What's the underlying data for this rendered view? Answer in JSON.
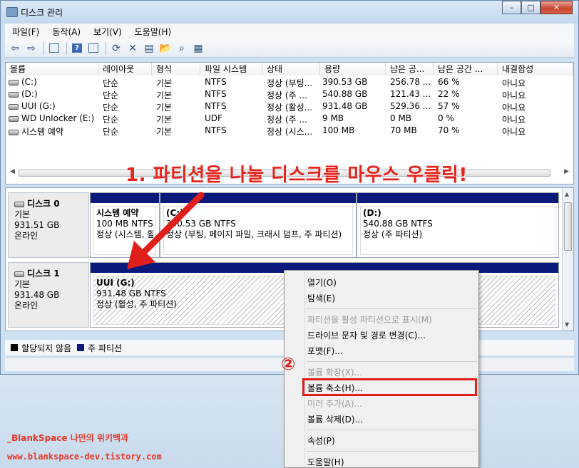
{
  "window": {
    "title": "디스크 관리",
    "buttons": [
      "–",
      "□",
      "✕"
    ]
  },
  "menubar": [
    "파일(F)",
    "동작(A)",
    "보기(V)",
    "도움말(H)"
  ],
  "toolbar": {
    "icons": [
      "back-arrow-icon",
      "forward-arrow-icon",
      "console-icon",
      "help-icon",
      "view-icon",
      "refresh-icon",
      "delete-icon",
      "properties-icon",
      "open-icon",
      "search-icon",
      "settings-icon"
    ]
  },
  "volume_list": {
    "columns": [
      "볼륨",
      "레이아웃",
      "형식",
      "파일 시스템",
      "상태",
      "용량",
      "남은 공...",
      "남은 공간 ...",
      "내결함성"
    ],
    "rows": [
      [
        "(C:)",
        "단순",
        "기본",
        "NTFS",
        "정상 (부팅...",
        "390.53 GB",
        "256.78 ...",
        "66 %",
        "아니요"
      ],
      [
        "(D:)",
        "단순",
        "기본",
        "NTFS",
        "정상 (주 ...",
        "540.88 GB",
        "121.43 ...",
        "22 %",
        "아니요"
      ],
      [
        "UUI (G:)",
        "단순",
        "기본",
        "NTFS",
        "정상 (활성...",
        "931.48 GB",
        "529.36 ...",
        "57 %",
        "아니요"
      ],
      [
        "WD Unlocker (E:)",
        "단순",
        "기본",
        "UDF",
        "정상 (주 ...",
        "9 MB",
        "0 MB",
        "0 %",
        "아니요"
      ],
      [
        "시스템 예약",
        "단순",
        "기본",
        "NTFS",
        "정상 (시스...",
        "100 MB",
        "70 MB",
        "70 %",
        "아니요"
      ]
    ]
  },
  "annotation1": "1. 파티션을 나눌 디스크를 마우스 우클릭!",
  "disks": [
    {
      "name": "디스크 0",
      "type": "기본",
      "size": "931.51 GB",
      "state": "온라인",
      "partitions": [
        {
          "name": "시스템 예약",
          "size": "100 MB NTFS",
          "status": "정상 (시스템, 활"
        },
        {
          "name": "(C:)",
          "size": "390.53 GB NTFS",
          "status": "정상 (부팅, 페이지 파일, 크래시 덤프, 주 파티션)"
        },
        {
          "name": "(D:)",
          "size": "540.88 GB NTFS",
          "status": "정상 (주 파티션)"
        }
      ]
    },
    {
      "name": "디스크 1",
      "type": "기본",
      "size": "931.48 GB",
      "state": "온라인",
      "partitions": [
        {
          "name": "UUI  (G:)",
          "size": "931.48 GB NTFS",
          "status": "정상 (활성, 주 파티션)"
        }
      ]
    }
  ],
  "legend": [
    {
      "label": "할당되지 않음",
      "color": "#000000"
    },
    {
      "label": "주 파티션",
      "color": "#0b1a7a"
    }
  ],
  "context_menu": {
    "items": [
      {
        "label": "열기(O)",
        "enabled": true
      },
      {
        "label": "탐색(E)",
        "enabled": true
      },
      {
        "label": "파티션을 활성 파티션으로 표시(M)",
        "enabled": false
      },
      {
        "label": "드라이브 문자 및 경로 변경(C)...",
        "enabled": true
      },
      {
        "label": "포맷(F)...",
        "enabled": true
      },
      {
        "label": "볼륨 확장(X)...",
        "enabled": false
      },
      {
        "label": "볼륨 축소(H)...",
        "enabled": true
      },
      {
        "label": "미러 추가(A)...",
        "enabled": false
      },
      {
        "label": "볼륨 삭제(D)...",
        "enabled": true
      },
      {
        "label": "속성(P)",
        "enabled": true
      },
      {
        "label": "도움말(H)",
        "enabled": true
      }
    ]
  },
  "annotation2": "②",
  "watermark": {
    "line1": "_BlankSpace 나만의 위키백과",
    "line2": "www.blankspace-dev.tistory.com"
  },
  "colors": {
    "accent": "#e8231c",
    "partition_bar": "#0b1a7a"
  }
}
